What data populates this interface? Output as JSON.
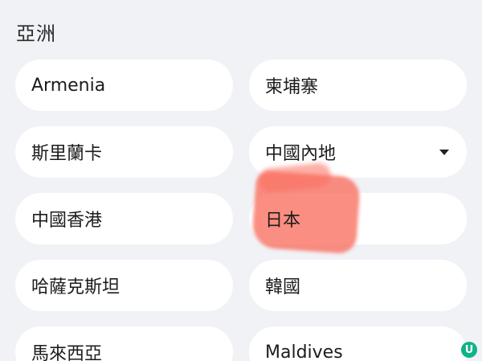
{
  "region": {
    "title": "亞洲"
  },
  "countries": [
    {
      "label": "Armenia"
    },
    {
      "label": "柬埔寨"
    },
    {
      "label": "斯里蘭卡"
    },
    {
      "label": "中國內地",
      "has_dropdown": true
    },
    {
      "label": "中國香港"
    },
    {
      "label": "日本",
      "highlighted": true
    },
    {
      "label": "哈薩克斯坦"
    },
    {
      "label": "韓國"
    },
    {
      "label": "馬來西亞"
    },
    {
      "label": "Maldives"
    }
  ],
  "watermark": {
    "logo_letter": "U",
    "icon": "u-logo-icon"
  },
  "colors": {
    "background": "#f1f2f6",
    "chip": "#ffffff",
    "highlight": "#fa6e5f",
    "watermark_logo": "#0fb388"
  }
}
